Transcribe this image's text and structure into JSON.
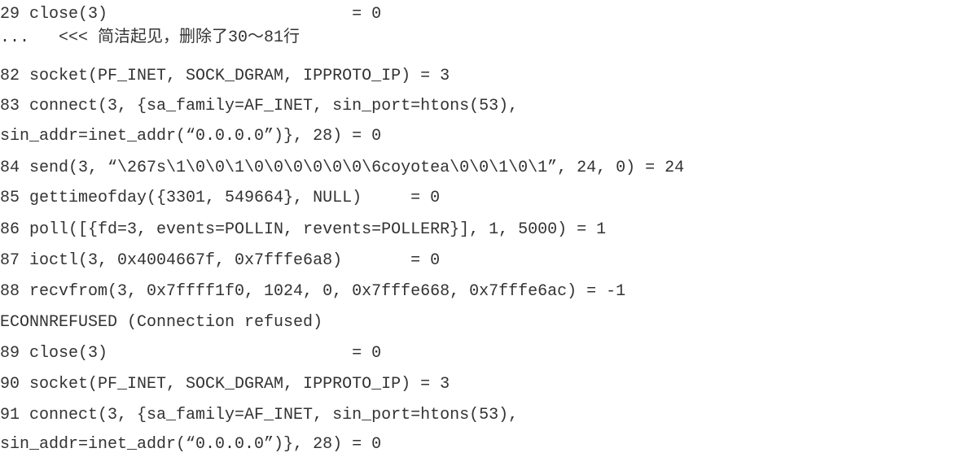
{
  "listing": {
    "lines": [
      "29 close(3)                         = 0",
      "...   <<< 简洁起见，删除了30～81行",
      "82 socket(PF_INET, SOCK_DGRAM, IPPROTO_IP) = 3",
      "83 connect(3, {sa_family=AF_INET, sin_port=htons(53),",
      "sin_addr=inet_addr(“0.0.0.0”)}, 28) = 0",
      "84 send(3, “\\267s\\1\\0\\0\\1\\0\\0\\0\\0\\0\\0\\6coyotea\\0\\0\\1\\0\\1”, 24, 0) = 24",
      "85 gettimeofday({3301, 549664}, NULL)     = 0",
      "86 poll([{fd=3, events=POLLIN, revents=POLLERR}], 1, 5000) = 1",
      "87 ioctl(3, 0x4004667f, 0x7fffe6a8)       = 0",
      "88 recvfrom(3, 0x7ffff1f0, 1024, 0, 0x7fffe668, 0x7fffe6ac) = -1",
      "ECONNREFUSED (Connection refused)",
      "89 close(3)                         = 0",
      "90 socket(PF_INET, SOCK_DGRAM, IPPROTO_IP) = 3",
      "91 connect(3, {sa_family=AF_INET, sin_port=htons(53),",
      "sin_addr=inet_addr(“0.0.0.0”)}, 28) = 0"
    ]
  }
}
